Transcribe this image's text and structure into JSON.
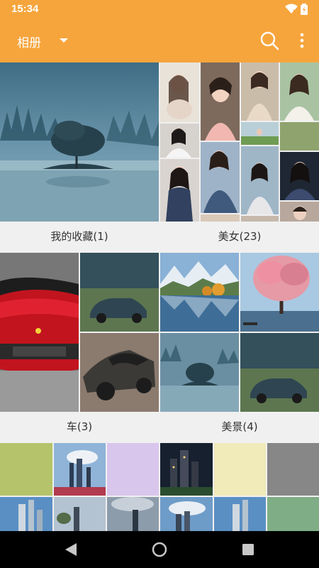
{
  "status_bar": {
    "time": "15:34"
  },
  "app_bar": {
    "title": "相册"
  },
  "albums": [
    {
      "label": "我的收藏(1)"
    },
    {
      "label": "美女(23)"
    },
    {
      "label": "车(3)"
    },
    {
      "label": "美景(4)"
    }
  ],
  "colors": {
    "accent": "#f6a53c",
    "background": "#f0f0f0",
    "swatch_olive": "#b5c46a",
    "swatch_lavender": "#d9c6ec",
    "swatch_cream": "#f1eab9",
    "swatch_gray": "#878787",
    "swatch_green": "#7fae86"
  },
  "icons": {
    "search": "search-icon",
    "more": "more-vertical-icon",
    "back": "back-icon",
    "home": "home-icon",
    "recents": "recents-icon"
  }
}
